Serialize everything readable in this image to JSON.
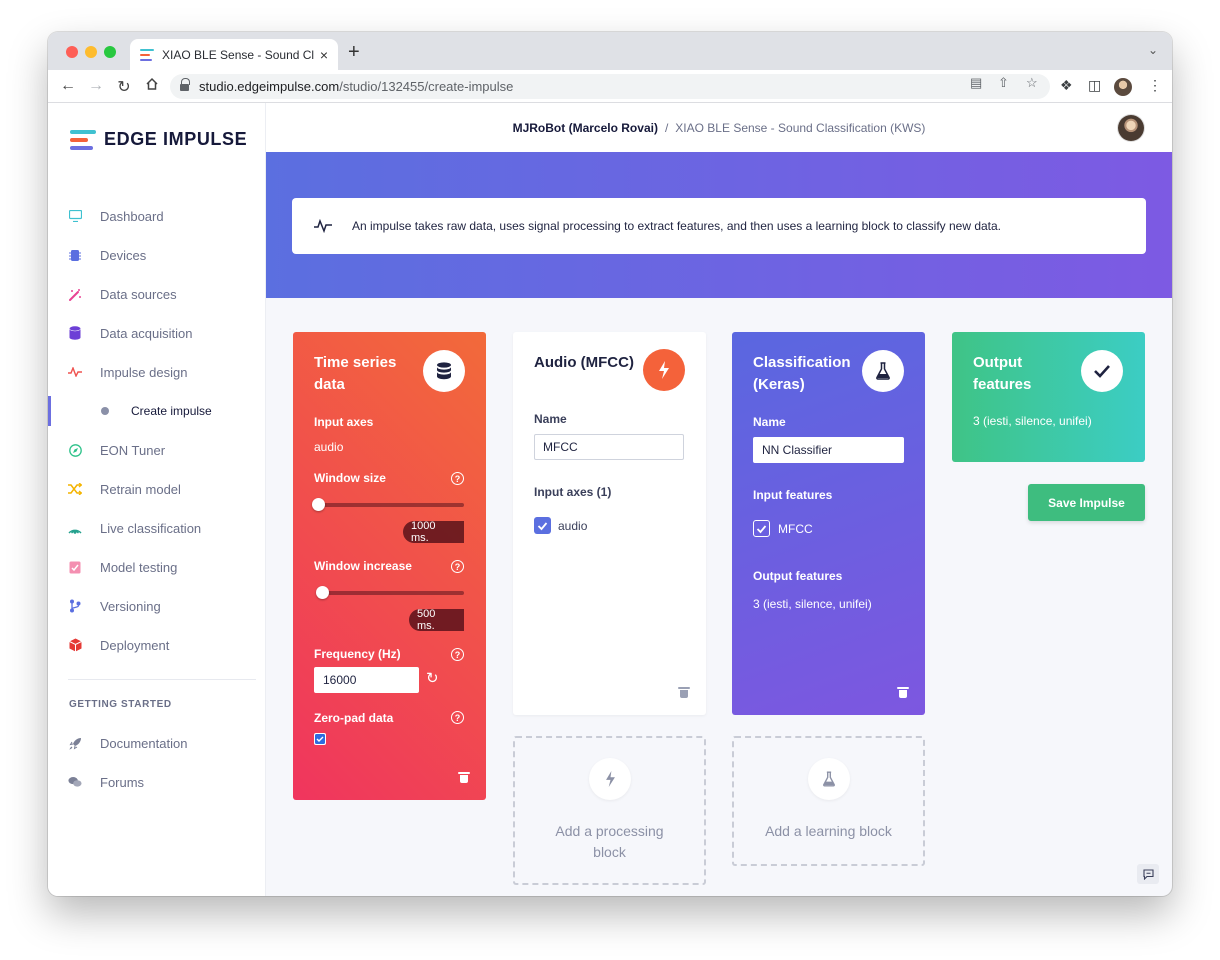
{
  "browser": {
    "tab_title": "XIAO BLE Sense - Sound Class",
    "tab_close": "×",
    "new_tab": "+",
    "url_host": "studio.edgeimpulse.com",
    "url_path": "/studio/132455/create-impulse"
  },
  "brand": {
    "logo_text": "EDGE IMPULSE"
  },
  "sidebar": {
    "items": [
      {
        "label": "Dashboard",
        "icon": "monitor-icon",
        "color": "#3fc1d0"
      },
      {
        "label": "Devices",
        "icon": "chip-icon",
        "color": "#5b6fe0"
      },
      {
        "label": "Data sources",
        "icon": "wand-icon",
        "color": "#e84393"
      },
      {
        "label": "Data acquisition",
        "icon": "database-icon",
        "color": "#6c3fd6"
      },
      {
        "label": "Impulse design",
        "icon": "pulse-icon",
        "color": "#ef5350"
      },
      {
        "label": "EON Tuner",
        "icon": "compass-icon",
        "color": "#2ec28a"
      },
      {
        "label": "Retrain model",
        "icon": "shuffle-icon",
        "color": "#f4b400"
      },
      {
        "label": "Live classification",
        "icon": "signal-icon",
        "color": "#25a18e"
      },
      {
        "label": "Model testing",
        "icon": "clipboard-check-icon",
        "color": "#f48fb1"
      },
      {
        "label": "Versioning",
        "icon": "branch-icon",
        "color": "#5b6fe0"
      },
      {
        "label": "Deployment",
        "icon": "cube-icon",
        "color": "#e53935"
      }
    ],
    "sub_item": "Create impulse",
    "section_heading": "GETTING STARTED",
    "footer_items": [
      {
        "label": "Documentation",
        "icon": "rocket-icon"
      },
      {
        "label": "Forums",
        "icon": "chat-icon"
      }
    ]
  },
  "header": {
    "user": "MJRoBot (Marcelo Rovai)",
    "separator": "/",
    "project": "XIAO BLE Sense - Sound Classification (KWS)"
  },
  "banner": {
    "info_text": "An impulse takes raw data, uses signal processing to extract features, and then uses a learning block to classify new data."
  },
  "input_block": {
    "title_line1": "Time series",
    "title_line2": "data",
    "input_axes_label": "Input axes",
    "input_axes_value": "audio",
    "window_size_label": "Window size",
    "window_size_value": "1000 ms.",
    "window_increase_label": "Window increase",
    "window_increase_value": "500 ms.",
    "frequency_label": "Frequency (Hz)",
    "frequency_value": "16000",
    "zero_pad_label": "Zero-pad data",
    "help_glyph": "?"
  },
  "processing_block": {
    "title": "Audio (MFCC)",
    "name_label": "Name",
    "name_value": "MFCC",
    "input_axes_label": "Input axes (1)",
    "axis_item": "audio"
  },
  "learning_block": {
    "title_line1": "Classification",
    "title_line2": "(Keras)",
    "name_label": "Name",
    "name_value": "NN Classifier",
    "input_features_label": "Input features",
    "input_feature_item": "MFCC",
    "output_features_label": "Output features",
    "output_features_value": "3 (iesti, silence, unifei)"
  },
  "output_block": {
    "title_line1": "Output",
    "title_line2": "features",
    "value": "3 (iesti, silence, unifei)"
  },
  "save_button": "Save Impulse",
  "add_processing": {
    "line1": "Add a processing",
    "line2": "block"
  },
  "add_learning": {
    "line1": "Add a learning block"
  },
  "colors": {
    "banner_start": "#5b6fe0",
    "banner_end": "#7d5ae3",
    "input_card_start": "#f0355e",
    "input_card_end": "#f26a3a",
    "processing_badge": "#f4623a",
    "learning_card_start": "#5a67e0",
    "learning_card_end": "#7d57e0",
    "output_card_start": "#3fc486",
    "output_card_end": "#3ccdc4",
    "save_button": "#3ebd7f"
  }
}
